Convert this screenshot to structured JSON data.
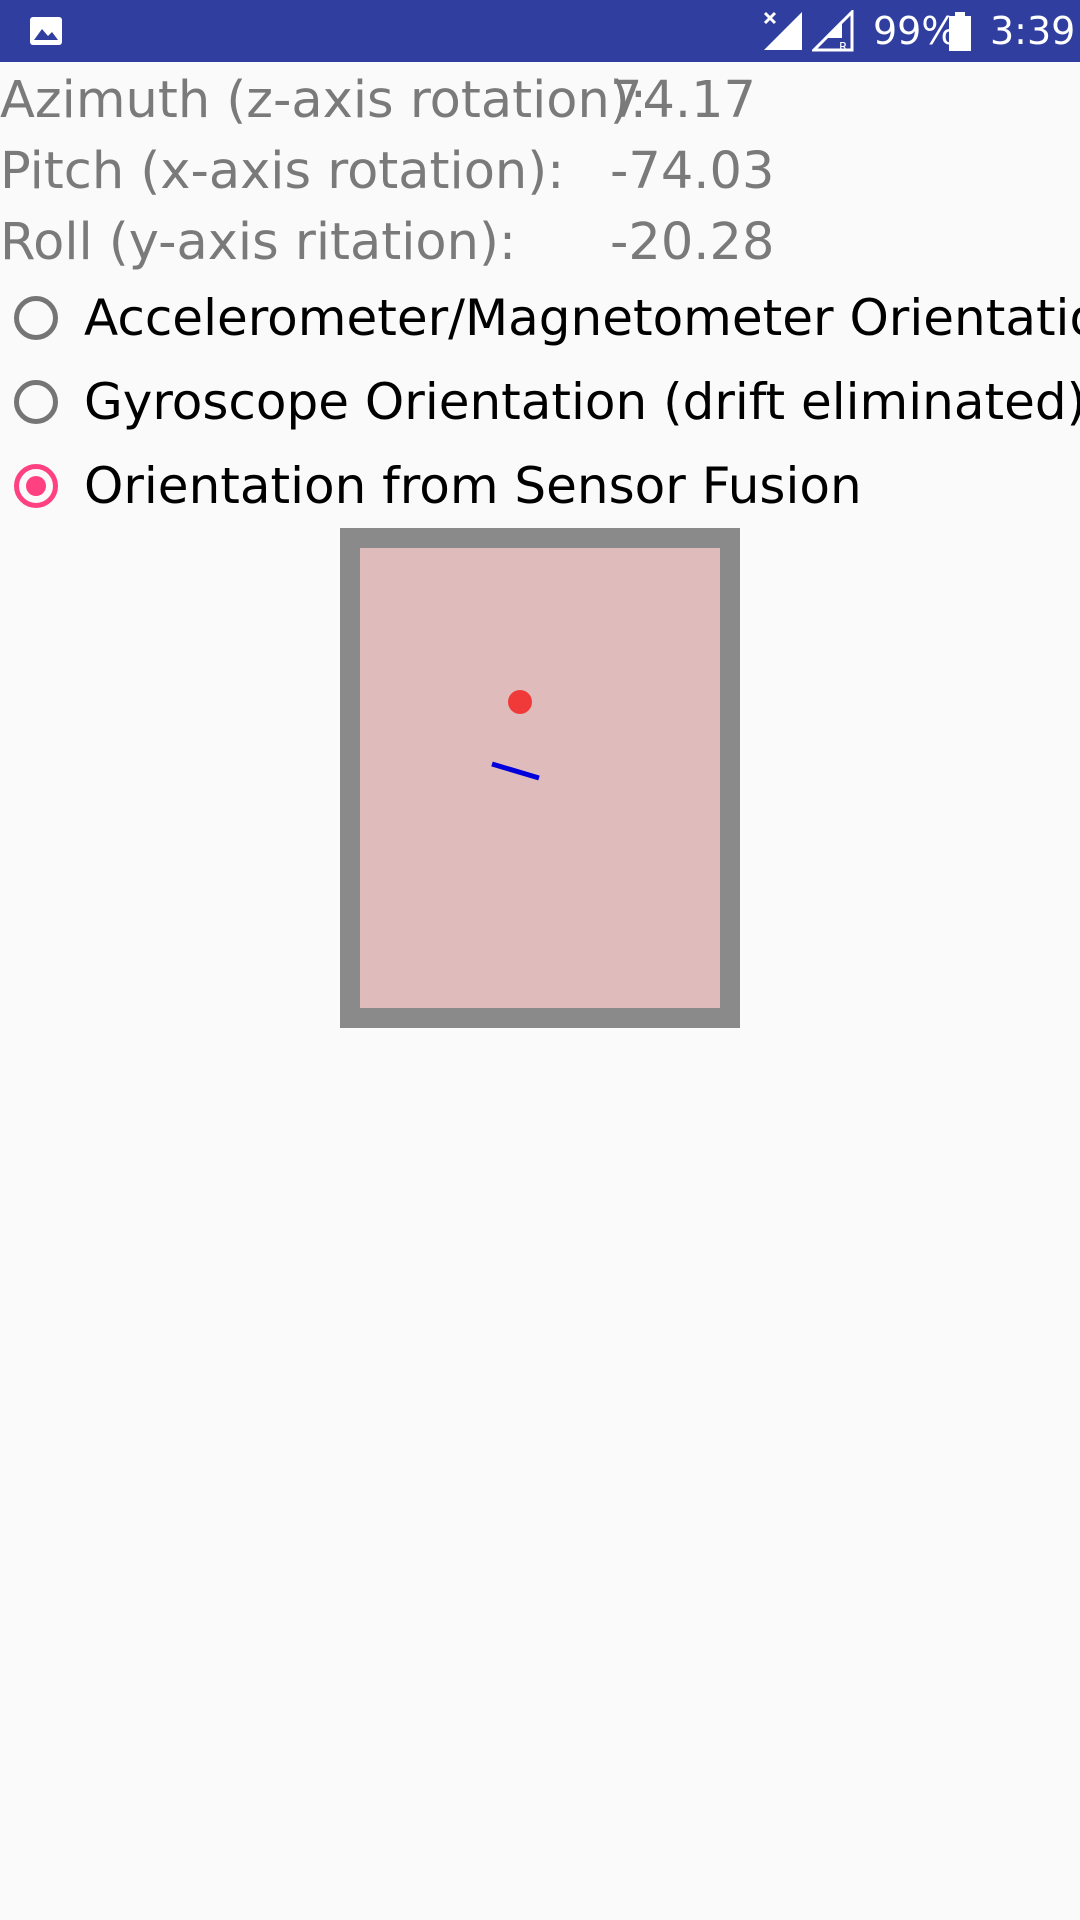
{
  "status_bar": {
    "battery_percent": "99%",
    "time": "3:39",
    "icons": [
      "gallery-icon",
      "signal-no-sim-icon",
      "signal-roaming-icon",
      "battery-icon"
    ],
    "signal_roaming_letter": "R",
    "background_color": "#303f9f"
  },
  "readouts": {
    "azimuth": {
      "label": "Azimuth (z-axis rotation):",
      "value": "74.17"
    },
    "pitch": {
      "label": "Pitch (x-axis rotation):",
      "value": "-74.03"
    },
    "roll": {
      "label": "Roll (y-axis ritation):",
      "value": "-20.28"
    }
  },
  "modes": {
    "accel_mag": {
      "label": "Accelerometer/Magnetometer Orientation",
      "checked": false
    },
    "gyroscope": {
      "label": "Gyroscope Orientation (drift eliminated)",
      "checked": false
    },
    "fusion": {
      "label": "Orientation from Sensor Fusion",
      "checked": true
    }
  },
  "colors": {
    "accent": "#ff4081",
    "frame": "#8a8a8a",
    "canvas": "#e0bbbb",
    "dot": "#f03a3a",
    "line": "#0000dd"
  }
}
